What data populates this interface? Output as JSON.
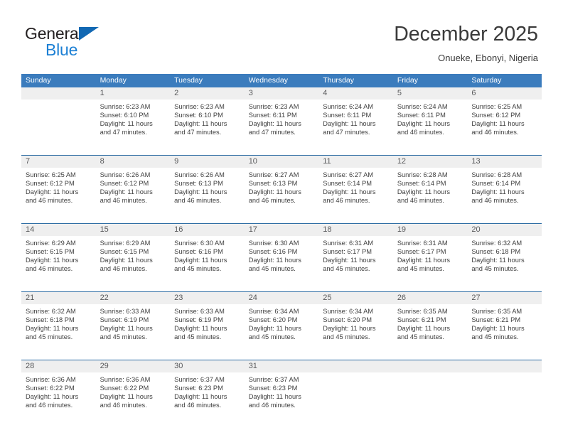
{
  "brand": {
    "line1": "General",
    "line2": "Blue",
    "triangle_color": "#1268b3"
  },
  "header": {
    "title": "December 2025",
    "subtitle": "Onueke, Ebonyi, Nigeria"
  },
  "colors": {
    "header_blue": "#3b7cbd",
    "separator_blue": "#2e6da4",
    "daynum_bg": "#efefef",
    "text": "#404040"
  },
  "weekdays": [
    "Sunday",
    "Monday",
    "Tuesday",
    "Wednesday",
    "Thursday",
    "Friday",
    "Saturday"
  ],
  "weeks": [
    [
      {
        "day": "",
        "sunrise": "",
        "sunset": "",
        "daylight1": "",
        "daylight2": ""
      },
      {
        "day": "1",
        "sunrise": "Sunrise: 6:23 AM",
        "sunset": "Sunset: 6:10 PM",
        "daylight1": "Daylight: 11 hours",
        "daylight2": "and 47 minutes."
      },
      {
        "day": "2",
        "sunrise": "Sunrise: 6:23 AM",
        "sunset": "Sunset: 6:10 PM",
        "daylight1": "Daylight: 11 hours",
        "daylight2": "and 47 minutes."
      },
      {
        "day": "3",
        "sunrise": "Sunrise: 6:23 AM",
        "sunset": "Sunset: 6:11 PM",
        "daylight1": "Daylight: 11 hours",
        "daylight2": "and 47 minutes."
      },
      {
        "day": "4",
        "sunrise": "Sunrise: 6:24 AM",
        "sunset": "Sunset: 6:11 PM",
        "daylight1": "Daylight: 11 hours",
        "daylight2": "and 47 minutes."
      },
      {
        "day": "5",
        "sunrise": "Sunrise: 6:24 AM",
        "sunset": "Sunset: 6:11 PM",
        "daylight1": "Daylight: 11 hours",
        "daylight2": "and 46 minutes."
      },
      {
        "day": "6",
        "sunrise": "Sunrise: 6:25 AM",
        "sunset": "Sunset: 6:12 PM",
        "daylight1": "Daylight: 11 hours",
        "daylight2": "and 46 minutes."
      }
    ],
    [
      {
        "day": "7",
        "sunrise": "Sunrise: 6:25 AM",
        "sunset": "Sunset: 6:12 PM",
        "daylight1": "Daylight: 11 hours",
        "daylight2": "and 46 minutes."
      },
      {
        "day": "8",
        "sunrise": "Sunrise: 6:26 AM",
        "sunset": "Sunset: 6:12 PM",
        "daylight1": "Daylight: 11 hours",
        "daylight2": "and 46 minutes."
      },
      {
        "day": "9",
        "sunrise": "Sunrise: 6:26 AM",
        "sunset": "Sunset: 6:13 PM",
        "daylight1": "Daylight: 11 hours",
        "daylight2": "and 46 minutes."
      },
      {
        "day": "10",
        "sunrise": "Sunrise: 6:27 AM",
        "sunset": "Sunset: 6:13 PM",
        "daylight1": "Daylight: 11 hours",
        "daylight2": "and 46 minutes."
      },
      {
        "day": "11",
        "sunrise": "Sunrise: 6:27 AM",
        "sunset": "Sunset: 6:14 PM",
        "daylight1": "Daylight: 11 hours",
        "daylight2": "and 46 minutes."
      },
      {
        "day": "12",
        "sunrise": "Sunrise: 6:28 AM",
        "sunset": "Sunset: 6:14 PM",
        "daylight1": "Daylight: 11 hours",
        "daylight2": "and 46 minutes."
      },
      {
        "day": "13",
        "sunrise": "Sunrise: 6:28 AM",
        "sunset": "Sunset: 6:14 PM",
        "daylight1": "Daylight: 11 hours",
        "daylight2": "and 46 minutes."
      }
    ],
    [
      {
        "day": "14",
        "sunrise": "Sunrise: 6:29 AM",
        "sunset": "Sunset: 6:15 PM",
        "daylight1": "Daylight: 11 hours",
        "daylight2": "and 46 minutes."
      },
      {
        "day": "15",
        "sunrise": "Sunrise: 6:29 AM",
        "sunset": "Sunset: 6:15 PM",
        "daylight1": "Daylight: 11 hours",
        "daylight2": "and 46 minutes."
      },
      {
        "day": "16",
        "sunrise": "Sunrise: 6:30 AM",
        "sunset": "Sunset: 6:16 PM",
        "daylight1": "Daylight: 11 hours",
        "daylight2": "and 45 minutes."
      },
      {
        "day": "17",
        "sunrise": "Sunrise: 6:30 AM",
        "sunset": "Sunset: 6:16 PM",
        "daylight1": "Daylight: 11 hours",
        "daylight2": "and 45 minutes."
      },
      {
        "day": "18",
        "sunrise": "Sunrise: 6:31 AM",
        "sunset": "Sunset: 6:17 PM",
        "daylight1": "Daylight: 11 hours",
        "daylight2": "and 45 minutes."
      },
      {
        "day": "19",
        "sunrise": "Sunrise: 6:31 AM",
        "sunset": "Sunset: 6:17 PM",
        "daylight1": "Daylight: 11 hours",
        "daylight2": "and 45 minutes."
      },
      {
        "day": "20",
        "sunrise": "Sunrise: 6:32 AM",
        "sunset": "Sunset: 6:18 PM",
        "daylight1": "Daylight: 11 hours",
        "daylight2": "and 45 minutes."
      }
    ],
    [
      {
        "day": "21",
        "sunrise": "Sunrise: 6:32 AM",
        "sunset": "Sunset: 6:18 PM",
        "daylight1": "Daylight: 11 hours",
        "daylight2": "and 45 minutes."
      },
      {
        "day": "22",
        "sunrise": "Sunrise: 6:33 AM",
        "sunset": "Sunset: 6:19 PM",
        "daylight1": "Daylight: 11 hours",
        "daylight2": "and 45 minutes."
      },
      {
        "day": "23",
        "sunrise": "Sunrise: 6:33 AM",
        "sunset": "Sunset: 6:19 PM",
        "daylight1": "Daylight: 11 hours",
        "daylight2": "and 45 minutes."
      },
      {
        "day": "24",
        "sunrise": "Sunrise: 6:34 AM",
        "sunset": "Sunset: 6:20 PM",
        "daylight1": "Daylight: 11 hours",
        "daylight2": "and 45 minutes."
      },
      {
        "day": "25",
        "sunrise": "Sunrise: 6:34 AM",
        "sunset": "Sunset: 6:20 PM",
        "daylight1": "Daylight: 11 hours",
        "daylight2": "and 45 minutes."
      },
      {
        "day": "26",
        "sunrise": "Sunrise: 6:35 AM",
        "sunset": "Sunset: 6:21 PM",
        "daylight1": "Daylight: 11 hours",
        "daylight2": "and 45 minutes."
      },
      {
        "day": "27",
        "sunrise": "Sunrise: 6:35 AM",
        "sunset": "Sunset: 6:21 PM",
        "daylight1": "Daylight: 11 hours",
        "daylight2": "and 45 minutes."
      }
    ],
    [
      {
        "day": "28",
        "sunrise": "Sunrise: 6:36 AM",
        "sunset": "Sunset: 6:22 PM",
        "daylight1": "Daylight: 11 hours",
        "daylight2": "and 46 minutes."
      },
      {
        "day": "29",
        "sunrise": "Sunrise: 6:36 AM",
        "sunset": "Sunset: 6:22 PM",
        "daylight1": "Daylight: 11 hours",
        "daylight2": "and 46 minutes."
      },
      {
        "day": "30",
        "sunrise": "Sunrise: 6:37 AM",
        "sunset": "Sunset: 6:23 PM",
        "daylight1": "Daylight: 11 hours",
        "daylight2": "and 46 minutes."
      },
      {
        "day": "31",
        "sunrise": "Sunrise: 6:37 AM",
        "sunset": "Sunset: 6:23 PM",
        "daylight1": "Daylight: 11 hours",
        "daylight2": "and 46 minutes."
      },
      {
        "day": "",
        "sunrise": "",
        "sunset": "",
        "daylight1": "",
        "daylight2": ""
      },
      {
        "day": "",
        "sunrise": "",
        "sunset": "",
        "daylight1": "",
        "daylight2": ""
      },
      {
        "day": "",
        "sunrise": "",
        "sunset": "",
        "daylight1": "",
        "daylight2": ""
      }
    ]
  ]
}
